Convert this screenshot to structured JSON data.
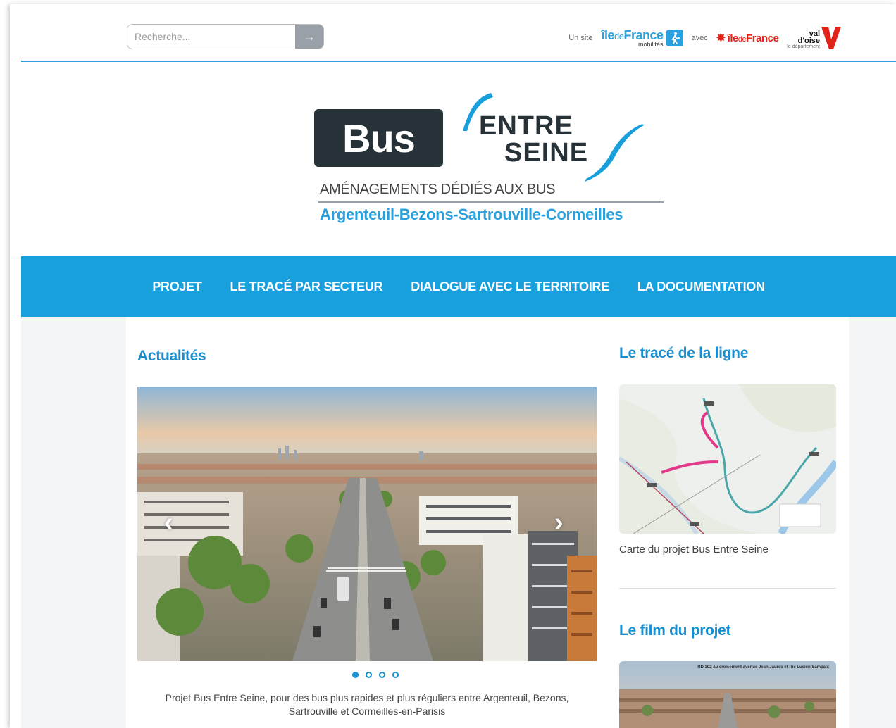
{
  "search": {
    "placeholder": "Recherche...",
    "button_icon": "arrow-right-icon"
  },
  "partners": {
    "un_site": "Un site",
    "idfm_main_1": "île",
    "idfm_main_de": "de",
    "idfm_main_2": "France",
    "idfm_sub": "mobilités",
    "avec": "avec",
    "region_1": "île",
    "region_de": "de",
    "region_2": "France",
    "vdo_line1": "val",
    "vdo_line2": "d'oise",
    "vdo_line3": "le département"
  },
  "logo": {
    "bus": "Bus",
    "entre": "ENTRE",
    "seine": "SEINE",
    "tagline": "AMÉNAGEMENTS DÉDIÉS AUX BUS",
    "cities": "Argenteuil-Bezons-Sartrouville-Cormeilles"
  },
  "nav": {
    "items": [
      {
        "label": "PROJET"
      },
      {
        "label": "LE TRACÉ PAR SECTEUR"
      },
      {
        "label": "DIALOGUE AVEC LE TERRITOIRE"
      },
      {
        "label": "LA DOCUMENTATION"
      }
    ]
  },
  "news": {
    "title": "Actualités",
    "caption": "Projet Bus Entre Seine, pour des bus plus rapides et plus réguliers entre Argenteuil, Bezons, Sartrouville et Cormeilles-en-Parisis",
    "prev_icon": "chevron-left-icon",
    "next_icon": "chevron-right-icon",
    "dots": 4,
    "active_dot": 1
  },
  "trace": {
    "title": "Le tracé de la ligne",
    "caption": "Carte du projet Bus Entre Seine"
  },
  "film": {
    "title": "Le film du projet",
    "overlay": "RD 392 au croisement avenue Jean Jaurès et rue Lucien Sampaix"
  },
  "colors": {
    "brand_blue": "#18a0dc",
    "dark": "#263238",
    "region_red": "#e2231a"
  }
}
